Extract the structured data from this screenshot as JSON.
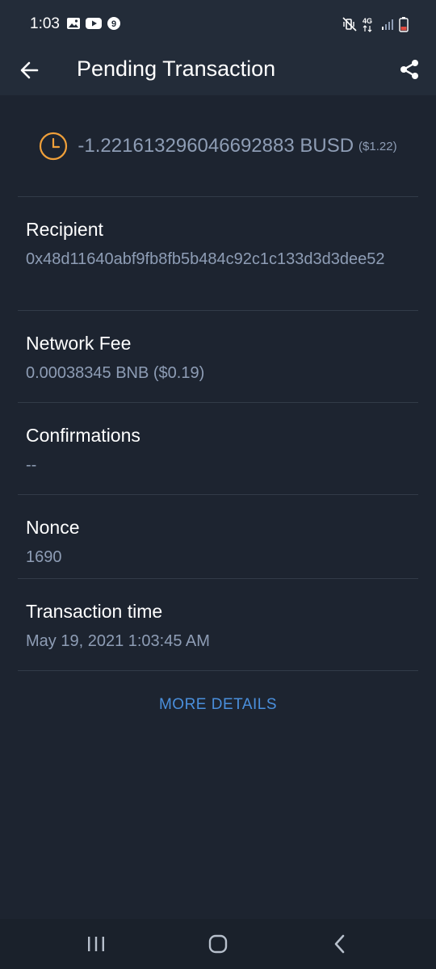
{
  "status_bar": {
    "time": "1:03",
    "icons_left": [
      "image-icon",
      "youtube-icon",
      "nine-badge-icon"
    ],
    "icons_right": [
      "mute-vibrate-icon",
      "4g-icon",
      "signal-icon",
      "battery-low-icon"
    ],
    "network_label": "4G"
  },
  "header": {
    "title": "Pending Transaction",
    "back_icon": "arrow-left-icon",
    "share_icon": "share-icon"
  },
  "amount": {
    "value": "-1.221613296046692883 BUSD",
    "fiat": "($1.22)",
    "status_icon": "clock-icon",
    "accent": "#f0a03a"
  },
  "details": {
    "recipient": {
      "label": "Recipient",
      "value": "0x48d11640abf9fb8fb5b484c92c1c133d3d3dee52"
    },
    "network_fee": {
      "label": "Network Fee",
      "value": "0.00038345 BNB ($0.19)"
    },
    "confirmations": {
      "label": "Confirmations",
      "value": "--"
    },
    "nonce": {
      "label": "Nonce",
      "value": "1690"
    },
    "transaction_time": {
      "label": "Transaction time",
      "value": "May 19, 2021 1:03:45 AM"
    }
  },
  "more_details": {
    "label": "MORE DETAILS",
    "color": "#4a8fdc"
  },
  "nav_bar": {
    "items": [
      "recent-apps-icon",
      "home-icon",
      "back-icon"
    ]
  },
  "colors": {
    "background": "#1d2430",
    "header": "#232c39",
    "value_text": "#8e9db5",
    "divider": "#323b48"
  }
}
